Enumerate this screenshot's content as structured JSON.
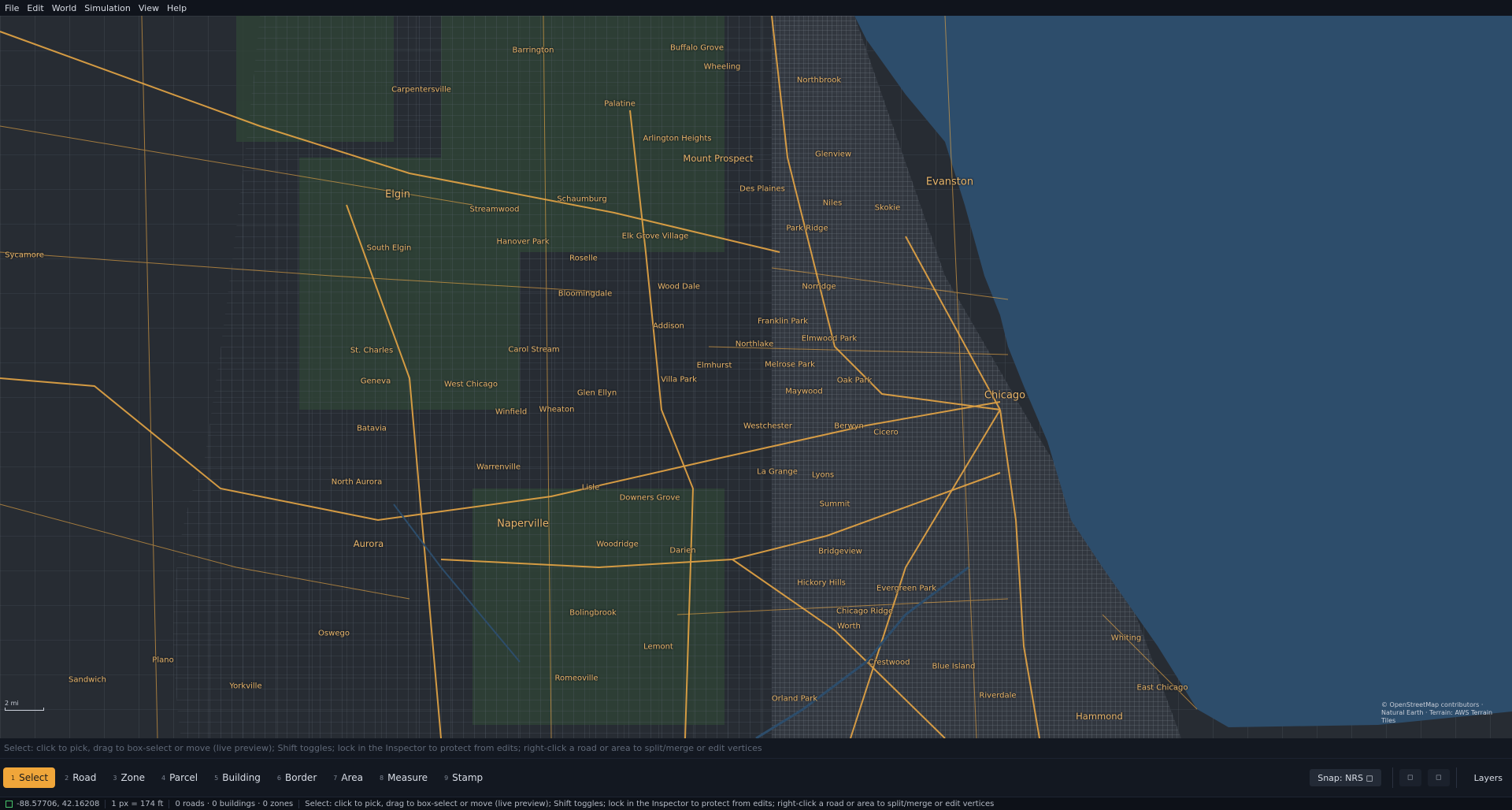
{
  "menu": [
    "File",
    "Edit",
    "World",
    "Simulation",
    "View",
    "Help"
  ],
  "map": {
    "lake_color": "#2d4d6b",
    "land_color": "#272c33",
    "road_color": "#e7a645",
    "places": [
      {
        "name": "Barrington"
      },
      {
        "name": "Buffalo Grove"
      },
      {
        "name": "Wheeling"
      },
      {
        "name": "Northbrook"
      },
      {
        "name": "Carpentersville"
      },
      {
        "name": "Palatine"
      },
      {
        "name": "Arlington Heights"
      },
      {
        "name": "Glenview"
      },
      {
        "name": "Mount Prospect"
      },
      {
        "name": "Evanston"
      },
      {
        "name": "Elgin"
      },
      {
        "name": "Schaumburg"
      },
      {
        "name": "Des Plaines"
      },
      {
        "name": "Streamwood"
      },
      {
        "name": "Niles"
      },
      {
        "name": "Skokie"
      },
      {
        "name": "South Elgin"
      },
      {
        "name": "Hanover Park"
      },
      {
        "name": "Elk Grove Village"
      },
      {
        "name": "Park Ridge"
      },
      {
        "name": "Sycamore"
      },
      {
        "name": "Roselle"
      },
      {
        "name": "Bloomingdale"
      },
      {
        "name": "Wood Dale"
      },
      {
        "name": "Norridge"
      },
      {
        "name": "Franklin Park"
      },
      {
        "name": "Addison"
      },
      {
        "name": "St. Charles"
      },
      {
        "name": "Carol Stream"
      },
      {
        "name": "Northlake"
      },
      {
        "name": "Elmwood Park"
      },
      {
        "name": "Geneva"
      },
      {
        "name": "West Chicago"
      },
      {
        "name": "Elmhurst"
      },
      {
        "name": "Melrose Park"
      },
      {
        "name": "Villa Park"
      },
      {
        "name": "Oak Park"
      },
      {
        "name": "Glen Ellyn"
      },
      {
        "name": "Maywood"
      },
      {
        "name": "Winfield"
      },
      {
        "name": "Wheaton"
      },
      {
        "name": "Chicago"
      },
      {
        "name": "Batavia"
      },
      {
        "name": "Westchester"
      },
      {
        "name": "Berwyn"
      },
      {
        "name": "Cicero"
      },
      {
        "name": "Warrenville"
      },
      {
        "name": "La Grange"
      },
      {
        "name": "Lyons"
      },
      {
        "name": "North Aurora"
      },
      {
        "name": "Lisle"
      },
      {
        "name": "Downers Grove"
      },
      {
        "name": "Summit"
      },
      {
        "name": "Naperville"
      },
      {
        "name": "Aurora"
      },
      {
        "name": "Woodridge"
      },
      {
        "name": "Darien"
      },
      {
        "name": "Bridgeview"
      },
      {
        "name": "Hickory Hills"
      },
      {
        "name": "Evergreen Park"
      },
      {
        "name": "Bolingbrook"
      },
      {
        "name": "Chicago Ridge"
      },
      {
        "name": "Worth"
      },
      {
        "name": "Oswego"
      },
      {
        "name": "Whiting"
      },
      {
        "name": "Lemont"
      },
      {
        "name": "Plano"
      },
      {
        "name": "Crestwood"
      },
      {
        "name": "Blue Island"
      },
      {
        "name": "Sandwich"
      },
      {
        "name": "Romeoville"
      },
      {
        "name": "Yorkville"
      },
      {
        "name": "East Chicago"
      },
      {
        "name": "Riverdale"
      },
      {
        "name": "Orland Park"
      },
      {
        "name": "Hammond"
      }
    ],
    "scale_label": "2 mi",
    "attribution": "© OpenStreetMap contributors · Natural Earth · Terrain: AWS Terrain Tiles"
  },
  "hint": "Select: click to pick, drag to box-select or move (live preview); Shift toggles; lock in the Inspector to protect from edits; right-click a road or area to split/merge or edit vertices",
  "tools": [
    {
      "key": "1",
      "label": "Select",
      "active": true
    },
    {
      "key": "2",
      "label": "Road",
      "active": false
    },
    {
      "key": "3",
      "label": "Zone",
      "active": false
    },
    {
      "key": "4",
      "label": "Parcel",
      "active": false
    },
    {
      "key": "5",
      "label": "Building",
      "active": false
    },
    {
      "key": "6",
      "label": "Border",
      "active": false
    },
    {
      "key": "7",
      "label": "Area",
      "active": false
    },
    {
      "key": "8",
      "label": "Measure",
      "active": false
    },
    {
      "key": "9",
      "label": "Stamp",
      "active": false
    }
  ],
  "snap_label": "Snap: NRS ◻",
  "square_buttons": [
    "◻",
    "◻"
  ],
  "layers_label": "Layers",
  "status": {
    "coords": "-88.57706, 42.16208",
    "scale": "1 px = 174 ft",
    "counts": "0 roads · 0 buildings · 0 zones",
    "message": "Select: click to pick, drag to box-select or move (live preview); Shift toggles; lock in the Inspector to protect from edits; right-click a road or area to split/merge or edit vertices"
  }
}
